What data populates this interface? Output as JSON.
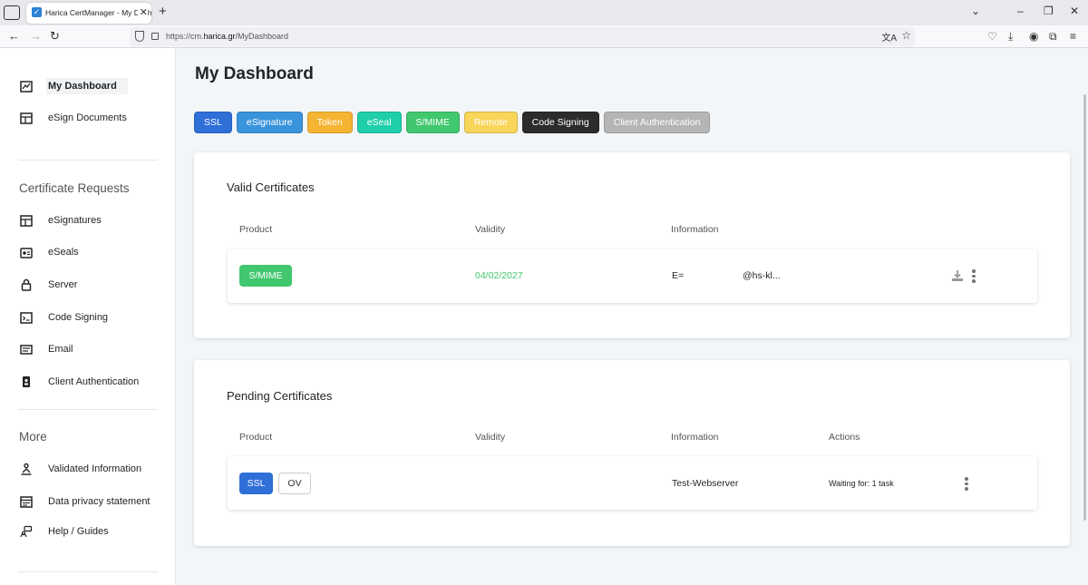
{
  "browser": {
    "tab_title": "Harica CertManager - My Dashl",
    "url_prefix": "https://cm.",
    "url_domain": "harica.gr",
    "url_path": "/MyDashboard"
  },
  "sidebar": {
    "top_items": [
      {
        "label": "My Dashboard",
        "icon": "dashboard-icon",
        "active": true
      },
      {
        "label": "eSign Documents",
        "icon": "document-grid-icon"
      }
    ],
    "section_requests": "Certificate Requests",
    "request_items": [
      {
        "label": "eSignatures",
        "icon": "signature-grid-icon"
      },
      {
        "label": "eSeals",
        "icon": "seal-icon"
      },
      {
        "label": "Server",
        "icon": "lock-icon"
      },
      {
        "label": "Code Signing",
        "icon": "terminal-icon"
      },
      {
        "label": "Email",
        "icon": "email-icon"
      },
      {
        "label": "Client Authentication",
        "icon": "badge-id-icon"
      }
    ],
    "section_more": "More",
    "more_items": [
      {
        "label": "Validated Information",
        "icon": "user-check-icon"
      },
      {
        "label": "Data privacy statement",
        "icon": "privacy-icon"
      },
      {
        "label": "Help / Guides",
        "icon": "help-icon"
      }
    ]
  },
  "main": {
    "title": "My Dashboard",
    "filters": [
      {
        "label": "SSL",
        "color": "#2f6fd8"
      },
      {
        "label": "eSignature",
        "color": "#3a94dc"
      },
      {
        "label": "Token",
        "color": "#f5b533"
      },
      {
        "label": "eSeal",
        "color": "#1fcfaa"
      },
      {
        "label": "S/MIME",
        "color": "#41c86f"
      },
      {
        "label": "Remote",
        "color": "#f8d65a"
      },
      {
        "label": "Code Signing",
        "color": "#2c2c2c"
      },
      {
        "label": "Client Authentication",
        "color": "#b5b5b5"
      }
    ],
    "valid": {
      "title": "Valid Certificates",
      "col_product": "Product",
      "col_validity": "Validity",
      "col_information": "Information",
      "row": {
        "product": "S/MIME",
        "product_color": "#41c86f",
        "validity": "04/02/2027",
        "validity_color": "#41c86f",
        "info_prefix": "E=",
        "info_value": "@hs-kl..."
      }
    },
    "pending": {
      "title": "Pending Certificates",
      "col_product": "Product",
      "col_validity": "Validity",
      "col_information": "Information",
      "col_actions": "Actions",
      "row": {
        "product": "SSL",
        "product_color": "#2f6fd8",
        "product_type": "OV",
        "information": "Test-Webserver",
        "actions": "Waiting for: 1 task"
      }
    }
  }
}
